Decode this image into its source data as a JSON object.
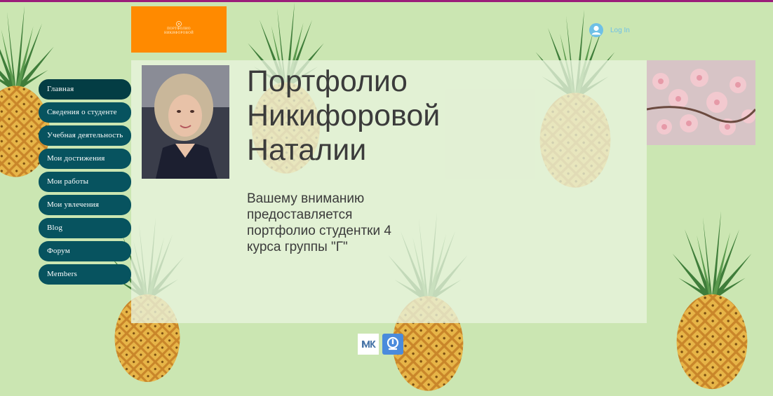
{
  "header": {
    "logo_lines": [
      "ПОРТФОЛИО",
      "НИКИФОРОВОЙ"
    ],
    "login_label": "Log In"
  },
  "nav": {
    "items": [
      {
        "label": "Главная",
        "active": true
      },
      {
        "label": "Сведения о студенте",
        "active": false
      },
      {
        "label": "Учебная деятельность",
        "active": false
      },
      {
        "label": "Мои достижения",
        "active": false
      },
      {
        "label": "Мои работы",
        "active": false
      },
      {
        "label": "Мои увлечения",
        "active": false
      },
      {
        "label": "Blog",
        "active": false
      },
      {
        "label": "Форум",
        "active": false
      },
      {
        "label": "Members",
        "active": false
      }
    ]
  },
  "main": {
    "title_lines": [
      "Портфолио",
      "Никифоровой",
      "Наталии"
    ],
    "subtitle_lines": [
      "Вашему вниманию",
      "предоставляется",
      "портфолио студентки 4",
      "курса группы \"Г\""
    ]
  },
  "social": {
    "vk_icon": "vk-icon",
    "second_icon": "blog-icon"
  },
  "colors": {
    "background": "#cbe6b2",
    "nav": "#07535f",
    "nav_active": "#033d44",
    "logo": "#ff8a00",
    "accent_line": "#9b1d7a",
    "login": "#6ec0e6"
  }
}
